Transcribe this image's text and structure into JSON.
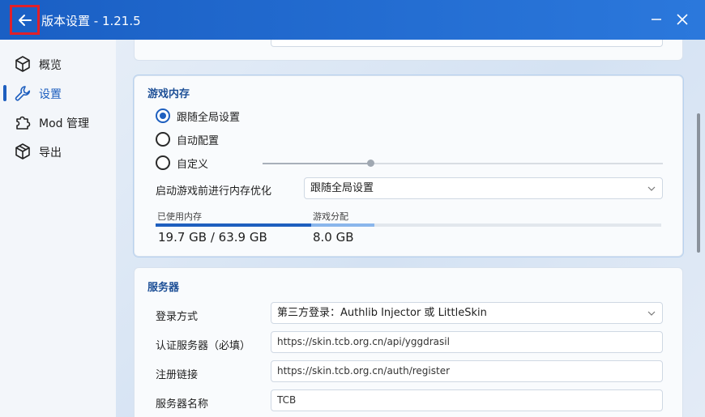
{
  "window": {
    "title": "版本设置 - 1.21.5",
    "back_icon": "arrow-left-icon",
    "minimize_icon": "minimize-icon",
    "close_icon": "close-icon"
  },
  "sidebar": {
    "items": [
      {
        "label": "概览",
        "icon": "cube-icon"
      },
      {
        "label": "设置",
        "icon": "wrench-icon",
        "active": true
      },
      {
        "label": "Mod 管理",
        "icon": "puzzle-icon"
      },
      {
        "label": "导出",
        "icon": "box-icon"
      }
    ]
  },
  "memory": {
    "title": "游戏内存",
    "options": [
      "跟随全局设置",
      "自动配置",
      "自定义"
    ],
    "selected": "跟随全局设置",
    "optimize_label": "启动游戏前进行内存优化",
    "optimize_value": "跟随全局设置",
    "used_label": "已使用内存",
    "alloc_label": "游戏分配",
    "used_value": "19.7 GB / 63.9 GB",
    "alloc_value": "8.0 GB",
    "used_fraction": 0.308,
    "alloc_fraction": 0.125
  },
  "server": {
    "title": "服务器",
    "login_label": "登录方式",
    "login_value": "第三方登录：Authlib Injector 或 LittleSkin",
    "auth_label": "认证服务器（必填）",
    "auth_value": "https://skin.tcb.org.cn/api/yggdrasil",
    "register_label": "注册链接",
    "register_value": "https://skin.tcb.org.cn/auth/register",
    "name_label": "服务器名称",
    "name_value": "TCB"
  },
  "colors": {
    "accent": "#1e5fbf",
    "titlebar": "#1f66cc"
  }
}
